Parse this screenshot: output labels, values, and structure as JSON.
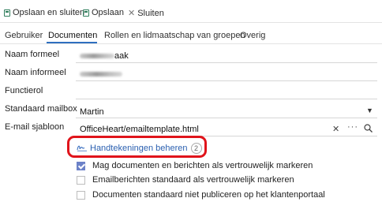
{
  "toolbar": {
    "save_close": "Opslaan en sluiten",
    "save": "Opslaan",
    "close": "Sluiten"
  },
  "tabs": [
    {
      "label": "Gebruiker",
      "active": false
    },
    {
      "label": "Documenten",
      "active": true
    },
    {
      "label": "Rollen en lidmaatschap van groepen",
      "active": false
    },
    {
      "label": "Overig",
      "active": false
    }
  ],
  "form": {
    "formal_name": {
      "label": "Naam formeel",
      "value_visible": "aak"
    },
    "informal_name": {
      "label": "Naam informeel"
    },
    "function_role": {
      "label": "Functierol",
      "value": ""
    },
    "default_mailbox": {
      "label": "Standaard mailbox",
      "value": "Martin"
    },
    "email_template": {
      "label": "E-mail sjabloon",
      "value": "OfficeHeart/emailtemplate.html"
    }
  },
  "signatures": {
    "label": "Handtekeningen beheren",
    "count": "2"
  },
  "checkboxes": [
    {
      "label": "Mag documenten en berichten als vertrouwelijk markeren",
      "checked": true
    },
    {
      "label": "Emailberichten standaard als vertrouwelijk markeren",
      "checked": false
    },
    {
      "label": "Documenten standaard niet publiceren op het klantenportaal",
      "checked": false
    }
  ],
  "colors": {
    "accent": "#2e6fbf",
    "highlight": "#e0141b",
    "checkbox_checked": "#6c82c8"
  }
}
